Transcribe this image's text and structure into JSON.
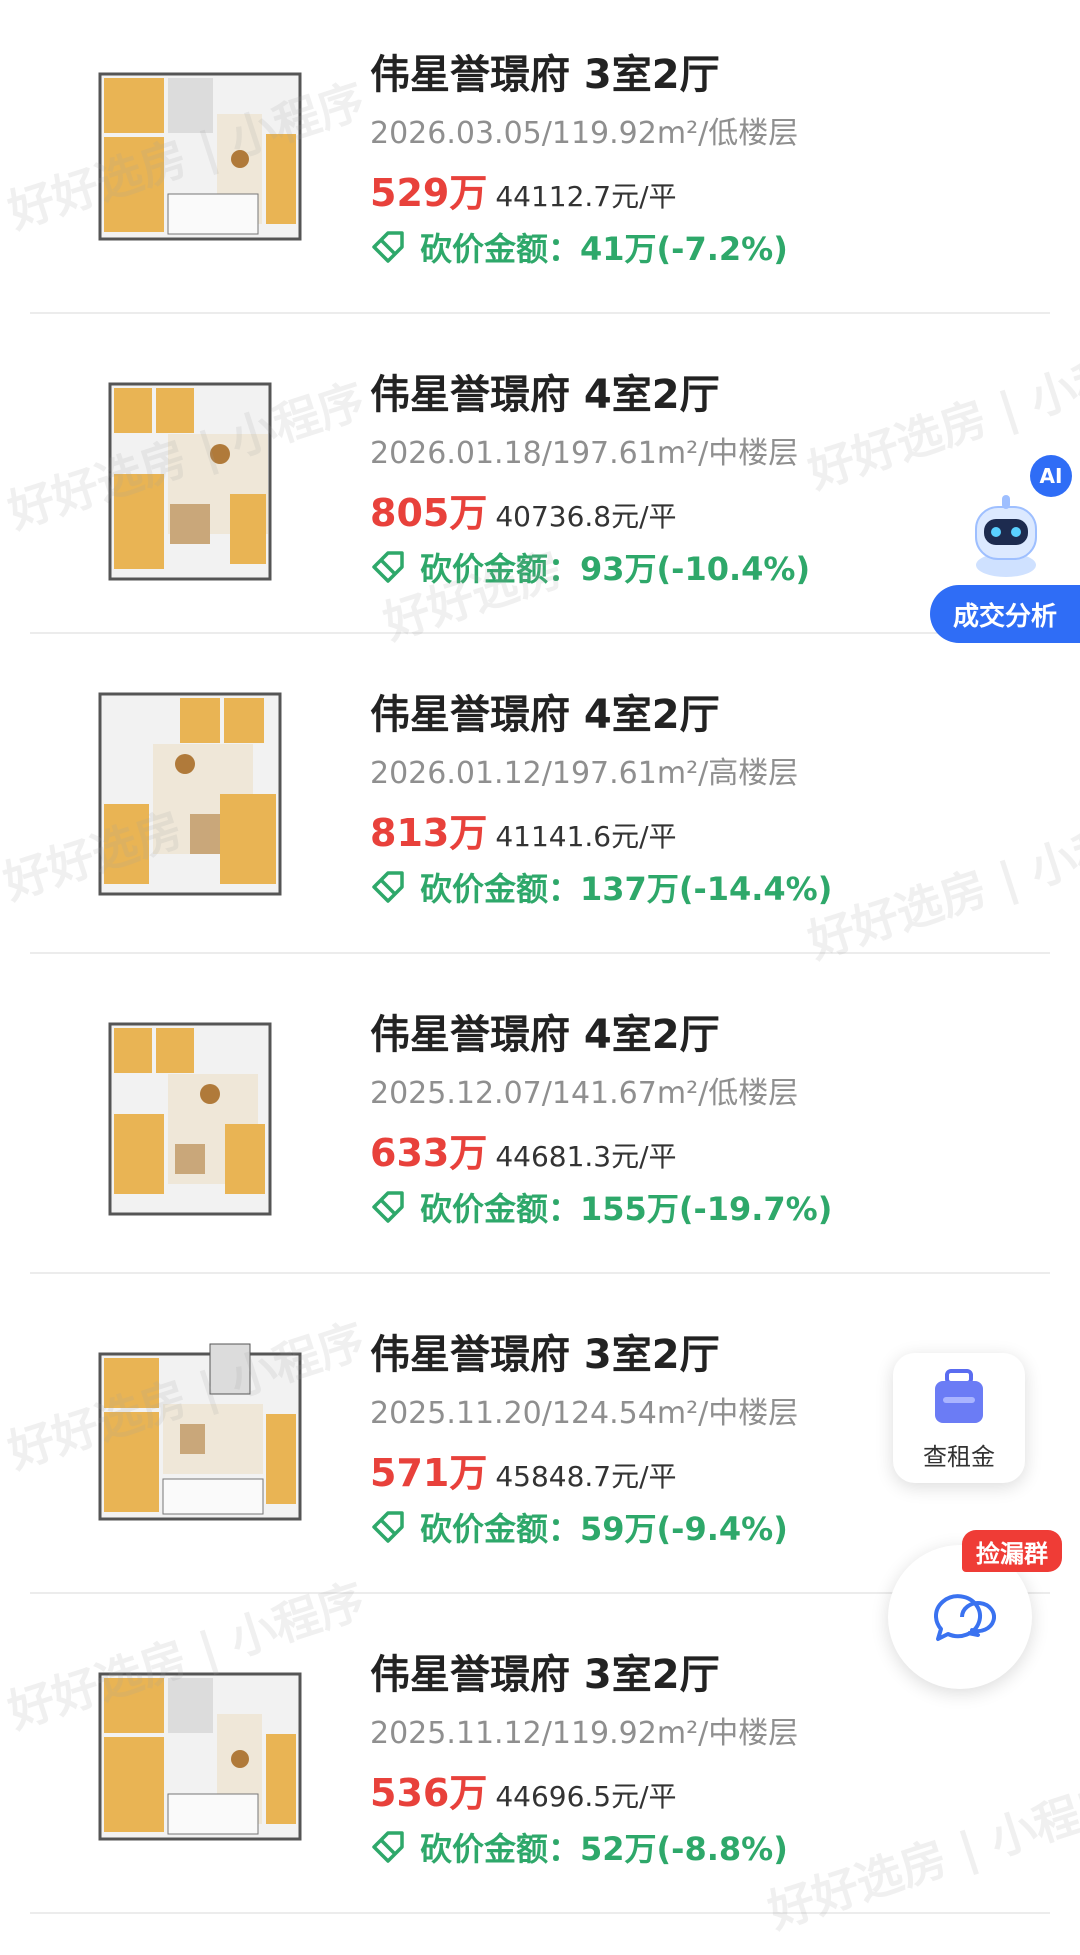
{
  "listings": [
    {
      "title": "伟星誉璟府 3室2厅",
      "meta": "2026.03.05/119.92m²/低楼层",
      "price": "529万",
      "unit_price": "44112.7元/平",
      "cut_label": "砍价金额：",
      "cut_value": "41万(-7.2%)"
    },
    {
      "title": "伟星誉璟府 4室2厅",
      "meta": "2026.01.18/197.61m²/中楼层",
      "price": "805万",
      "unit_price": "40736.8元/平",
      "cut_label": "砍价金额：",
      "cut_value": "93万(-10.4%)"
    },
    {
      "title": "伟星誉璟府 4室2厅",
      "meta": "2026.01.12/197.61m²/高楼层",
      "price": "813万",
      "unit_price": "41141.6元/平",
      "cut_label": "砍价金额：",
      "cut_value": "137万(-14.4%)"
    },
    {
      "title": "伟星誉璟府 4室2厅",
      "meta": "2025.12.07/141.67m²/低楼层",
      "price": "633万",
      "unit_price": "44681.3元/平",
      "cut_label": "砍价金额：",
      "cut_value": "155万(-19.7%)"
    },
    {
      "title": "伟星誉璟府 3室2厅",
      "meta": "2025.11.20/124.54m²/中楼层",
      "price": "571万",
      "unit_price": "45848.7元/平",
      "cut_label": "砍价金额：",
      "cut_value": "59万(-9.4%)"
    },
    {
      "title": "伟星誉璟府 3室2厅",
      "meta": "2025.11.12/119.92m²/中楼层",
      "price": "536万",
      "unit_price": "44696.5元/平",
      "cut_label": "砍价金额：",
      "cut_value": "52万(-8.8%)"
    }
  ],
  "watermark": {
    "brand": "好好选房",
    "sub": "小程序"
  },
  "ai_widget": {
    "badge": "AI",
    "label": "成交分析",
    "icon": "robot-icon"
  },
  "rent_widget": {
    "label": "查租金",
    "icon": "briefcase-icon"
  },
  "chat_widget": {
    "badge": "捡漏群",
    "icon": "chat-bubbles-icon"
  },
  "colors": {
    "price": "#e8413b",
    "discount": "#2ea86a",
    "accent": "#2f6df6",
    "badge": "#ef3c36"
  }
}
